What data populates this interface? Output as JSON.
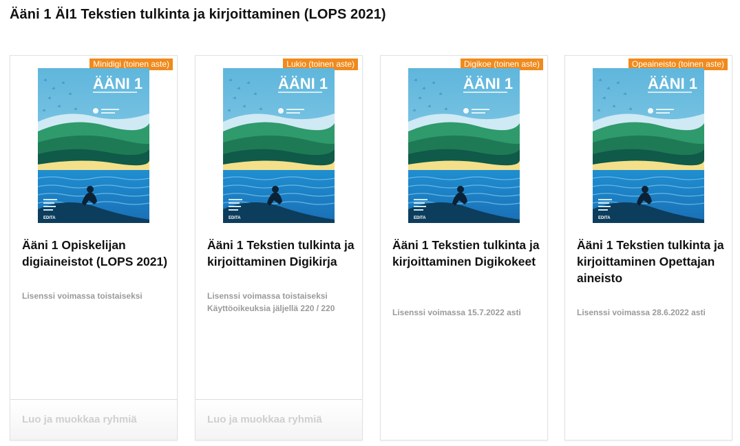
{
  "page": {
    "title": "Ääni 1 ÄI1 Tekstien tulkinta ja kirjoittaminen (LOPS 2021)"
  },
  "cover": {
    "book_title": "ÄÄNI 1",
    "publisher": "EDITA",
    "accent_color": "#f08a1c"
  },
  "cards": [
    {
      "badge": "Minidigi (toinen aste)",
      "title": "Ääni 1 Opiskelijan digiaineistot (LOPS 2021)",
      "meta": [
        "Lisenssi voimassa toistaiseksi"
      ],
      "footer_link": "Luo ja muokkaa ryhmiä"
    },
    {
      "badge": "Lukio (toinen aste)",
      "title": "Ääni 1 Tekstien tulkinta ja kirjoittaminen Digikirja",
      "meta": [
        "Lisenssi voimassa toistaiseksi",
        "Käyttöoikeuksia jäljellä 220 / 220"
      ],
      "footer_link": "Luo ja muokkaa ryhmiä"
    },
    {
      "badge": "Digikoe (toinen aste)",
      "title": "Ääni 1 Tekstien tulkinta ja kirjoittaminen Digikokeet",
      "meta": [
        "Lisenssi voimassa 15.7.2022 asti"
      ]
    },
    {
      "badge": "Opeaineisto (toinen aste)",
      "title": "Ääni 1 Tekstien tulkinta ja kirjoittaminen Opettajan aineisto",
      "meta": [
        "Lisenssi voimassa 28.6.2022 asti"
      ]
    }
  ]
}
